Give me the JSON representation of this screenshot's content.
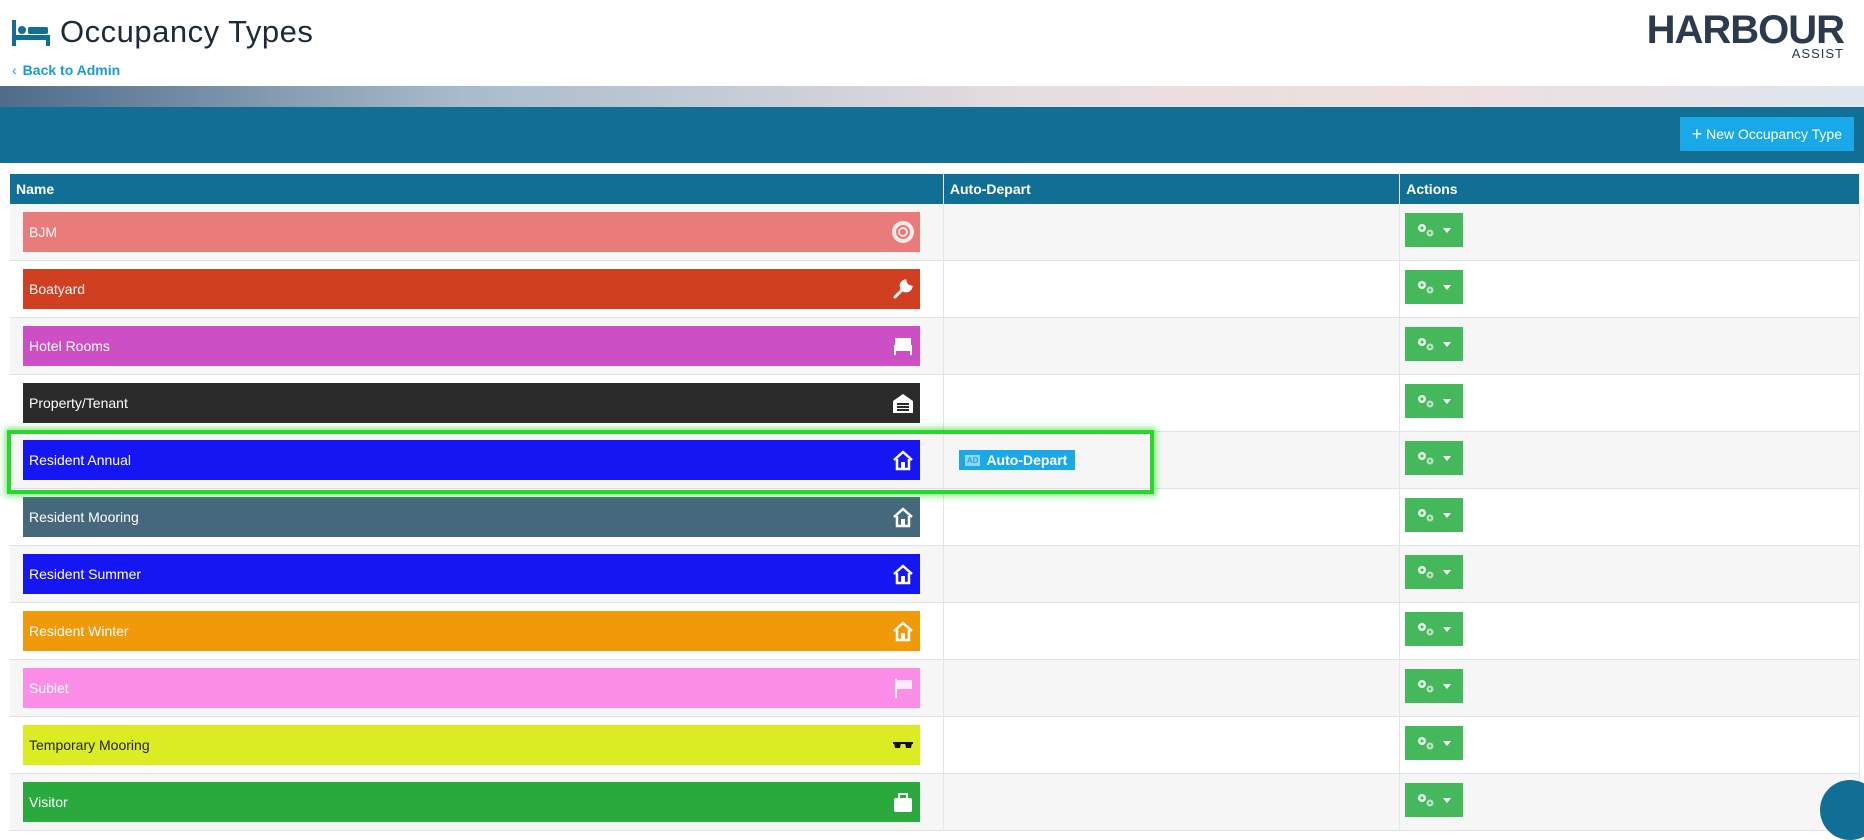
{
  "header": {
    "title": "Occupancy Types",
    "back_label": "Back to Admin",
    "logo_main": "HARBOUR",
    "logo_sub": "ASSIST",
    "title_icon": "bed-icon"
  },
  "toolbar": {
    "new_button_label": "New Occupancy Type"
  },
  "table": {
    "columns": [
      "Name",
      "Auto-Depart",
      "Actions"
    ],
    "rows": [
      {
        "name": "BJM",
        "color": "#e97b7b",
        "icon": "life-ring-icon",
        "auto_depart": ""
      },
      {
        "name": "Boatyard",
        "color": "#d03f20",
        "icon": "wrench-icon",
        "auto_depart": ""
      },
      {
        "name": "Hotel Rooms",
        "color": "#cc4fc4",
        "icon": "bed-icon",
        "auto_depart": ""
      },
      {
        "name": "Property/Tenant",
        "color": "#2b2b2b",
        "icon": "garage-icon",
        "auto_depart": ""
      },
      {
        "name": "Resident Annual",
        "color": "#1616f2",
        "icon": "house-icon",
        "auto_depart": "Auto-Depart"
      },
      {
        "name": "Resident Mooring",
        "color": "#46687c",
        "icon": "house-icon",
        "auto_depart": ""
      },
      {
        "name": "Resident Summer",
        "color": "#1616f2",
        "icon": "house-icon",
        "auto_depart": ""
      },
      {
        "name": "Resident Winter",
        "color": "#f09a0a",
        "icon": "house-icon",
        "auto_depart": ""
      },
      {
        "name": "Sublet",
        "color": "#fd8ee8",
        "icon": "flag-icon",
        "auto_depart": ""
      },
      {
        "name": "Temporary Mooring",
        "color": "#dcec22",
        "icon": "sunglasses-icon",
        "auto_depart": ""
      },
      {
        "name": "Visitor",
        "color": "#2aaa3d",
        "icon": "suitcase-icon",
        "auto_depart": ""
      }
    ]
  },
  "badge_mini": "AD",
  "colors": {
    "header_band": "#116f96",
    "accent_blue": "#1aa9e8",
    "action_green": "#44b85a",
    "highlight": "#2bd62b"
  }
}
